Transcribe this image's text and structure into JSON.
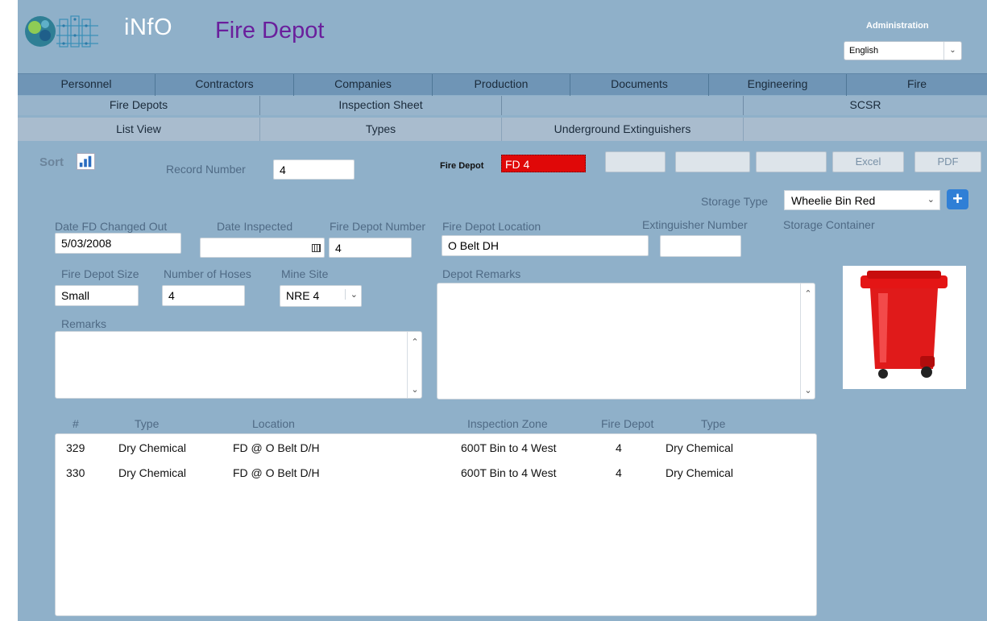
{
  "app": {
    "name": "iNfO",
    "page_title": "Fire Depot",
    "admin_label": "Administration",
    "language": "English"
  },
  "nav": {
    "primary": [
      "Personnel",
      "Contractors",
      "Companies",
      "Production",
      "Documents",
      "Engineering",
      "Fire"
    ],
    "secondary": [
      "Fire Depots",
      "Inspection Sheet",
      "",
      "SCSR"
    ],
    "tertiary": [
      "List View",
      "Types",
      "Underground Extinguishers",
      ""
    ]
  },
  "toolbar": {
    "sort_label": "Sort",
    "record_number_label": "Record Number",
    "record_number": "4",
    "fire_depot_label": "Fire Depot",
    "fire_depot_value": "FD 4",
    "excel_label": "Excel",
    "pdf_label": "PDF"
  },
  "form": {
    "storage_type_label": "Storage Type",
    "storage_type": "Wheelie Bin Red",
    "date_changed_label": "Date FD Changed Out",
    "date_changed": "5/03/2008",
    "date_inspected_label": "Date Inspected",
    "date_inspected": "",
    "fd_number_label": "Fire Depot Number",
    "fd_number": "4",
    "fd_location_label": "Fire Depot Location",
    "fd_location": "O Belt DH",
    "extinguisher_label": "Extinguisher Number",
    "extinguisher": "",
    "storage_container_label": "Storage Container",
    "size_label": "Fire Depot Size",
    "size": "Small",
    "hoses_label": "Number of Hoses",
    "hoses": "4",
    "mine_site_label": "Mine Site",
    "mine_site": "NRE 4",
    "depot_remarks_label": "Depot Remarks",
    "remarks_label": "Remarks"
  },
  "table": {
    "headers": [
      "#",
      "Type",
      "Location",
      "Inspection Zone",
      "Fire Depot",
      "Type"
    ],
    "rows": [
      [
        "329",
        "Dry Chemical",
        "FD @ O Belt D/H",
        "600T Bin to 4 West",
        "4",
        "Dry Chemical"
      ],
      [
        "330",
        "Dry Chemical",
        "FD @ O Belt D/H",
        "600T Bin to 4 West",
        "4",
        "Dry Chemical"
      ]
    ]
  },
  "colors": {
    "background": "#8fb0c9",
    "title": "#6a1f9c",
    "fire_depot_badge": "#e00808",
    "plus_button": "#2f7fd6"
  }
}
